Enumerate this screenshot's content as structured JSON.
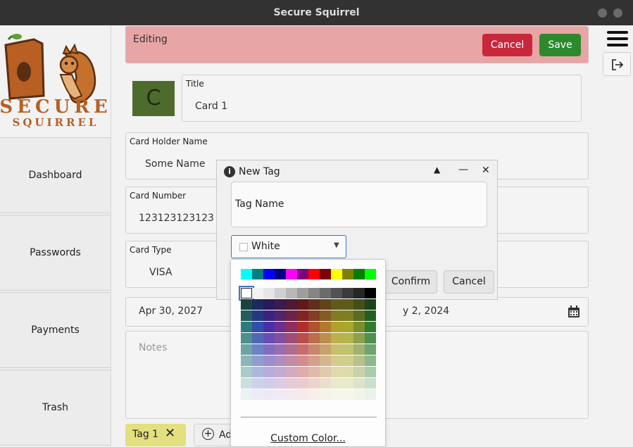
{
  "window": {
    "title": "Secure Squirrel"
  },
  "sidebar": {
    "logo_text_1": "SECURE",
    "logo_text_2": "SQUIRREL",
    "items": [
      {
        "label": "Dashboard"
      },
      {
        "label": "Passwords"
      },
      {
        "label": "Payments"
      },
      {
        "label": "Trash"
      }
    ]
  },
  "editor": {
    "status": "Editing",
    "cancel_label": "Cancel",
    "save_label": "Save",
    "avatar_letter": "C",
    "avatar_color": "#4d6b2c",
    "title_label": "Title",
    "title_value": "Card 1",
    "holder_label": "Card Holder Name",
    "holder_value": "Some Name",
    "number_label": "Card Number",
    "number_value": "123123123123",
    "type_label": "Card Type",
    "type_value": "VISA",
    "expiry_value": "Apr 30, 2027",
    "second_date_value": "y 2, 2024",
    "notes_placeholder": "Notes",
    "tag_label": "Tag 1",
    "tag_color": "#e3e07f",
    "add_label": "Ad"
  },
  "dialog": {
    "title": "New Tag",
    "name_placeholder": "Tag Name",
    "color_selected": "White",
    "confirm_label": "Confirm",
    "cancel_label": "Cancel"
  },
  "color_popup": {
    "custom_label": "Custom Color...",
    "top_row": [
      "#00ffff",
      "#008080",
      "#0000ff",
      "#000080",
      "#ff00ff",
      "#800080",
      "#ff0000",
      "#800000",
      "#ffff00",
      "#808000",
      "#008000",
      "#00ff00"
    ],
    "gray_row": [
      "#ffffff",
      "#f2f2f2",
      "#e6e6e6",
      "#d0d0d0",
      "#b8b8b8",
      "#9e9e9e",
      "#858585",
      "#6b6b6b",
      "#525252",
      "#3b3b3b",
      "#262626",
      "#000000"
    ],
    "hues": [
      "#2e7b7b",
      "#2f4fa8",
      "#4b2fa8",
      "#6e2e8e",
      "#8e2e5e",
      "#b02e2e",
      "#b0532e",
      "#b07a2e",
      "#b0a22e",
      "#a8a82e",
      "#7a8e2e",
      "#2e7e2e"
    ]
  },
  "colors": {
    "cancel_red": "#c8283c",
    "save_green": "#2c8a2c",
    "editing_bg": "#e8a5a5"
  }
}
